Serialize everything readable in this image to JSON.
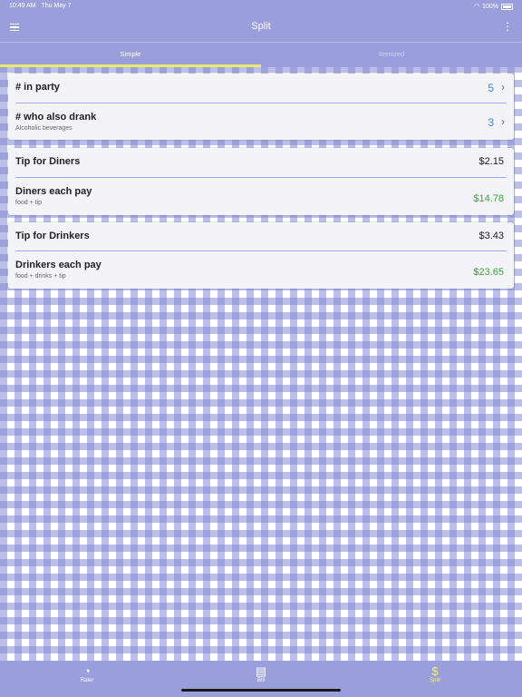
{
  "status": {
    "time": "10:49 AM",
    "date": "Thu May 7",
    "battery": "100%"
  },
  "header": {
    "title": "Split"
  },
  "tabs": [
    {
      "label": "Simple",
      "active": true
    },
    {
      "label": "Itemized",
      "active": false
    }
  ],
  "party": {
    "in_party_label": "# in party",
    "in_party_value": "5",
    "drank_label": "# who also drank",
    "drank_sub": "Alcoholic beverages",
    "drank_value": "3"
  },
  "diners": {
    "tip_label": "Tip for Diners",
    "tip_value": "$2.15",
    "pay_label": "Diners each pay",
    "pay_sub": "food + tip",
    "pay_value": "$14.78"
  },
  "drinkers": {
    "tip_label": "Tip for Drinkers",
    "tip_value": "$3.43",
    "pay_label": "Drinkers each pay",
    "pay_sub": "food + drinks + tip",
    "pay_value": "$23.65"
  },
  "bottom_nav": [
    {
      "label": "Rater",
      "icon": "rater-icon"
    },
    {
      "label": "Bill",
      "icon": "bill-icon"
    },
    {
      "label": "Split",
      "icon": "split-icon",
      "active": true
    }
  ],
  "colors": {
    "bar": "#9a9fdb",
    "accent": "#e9ea6a",
    "blue": "#2a8fe0",
    "green": "#3aa640"
  }
}
